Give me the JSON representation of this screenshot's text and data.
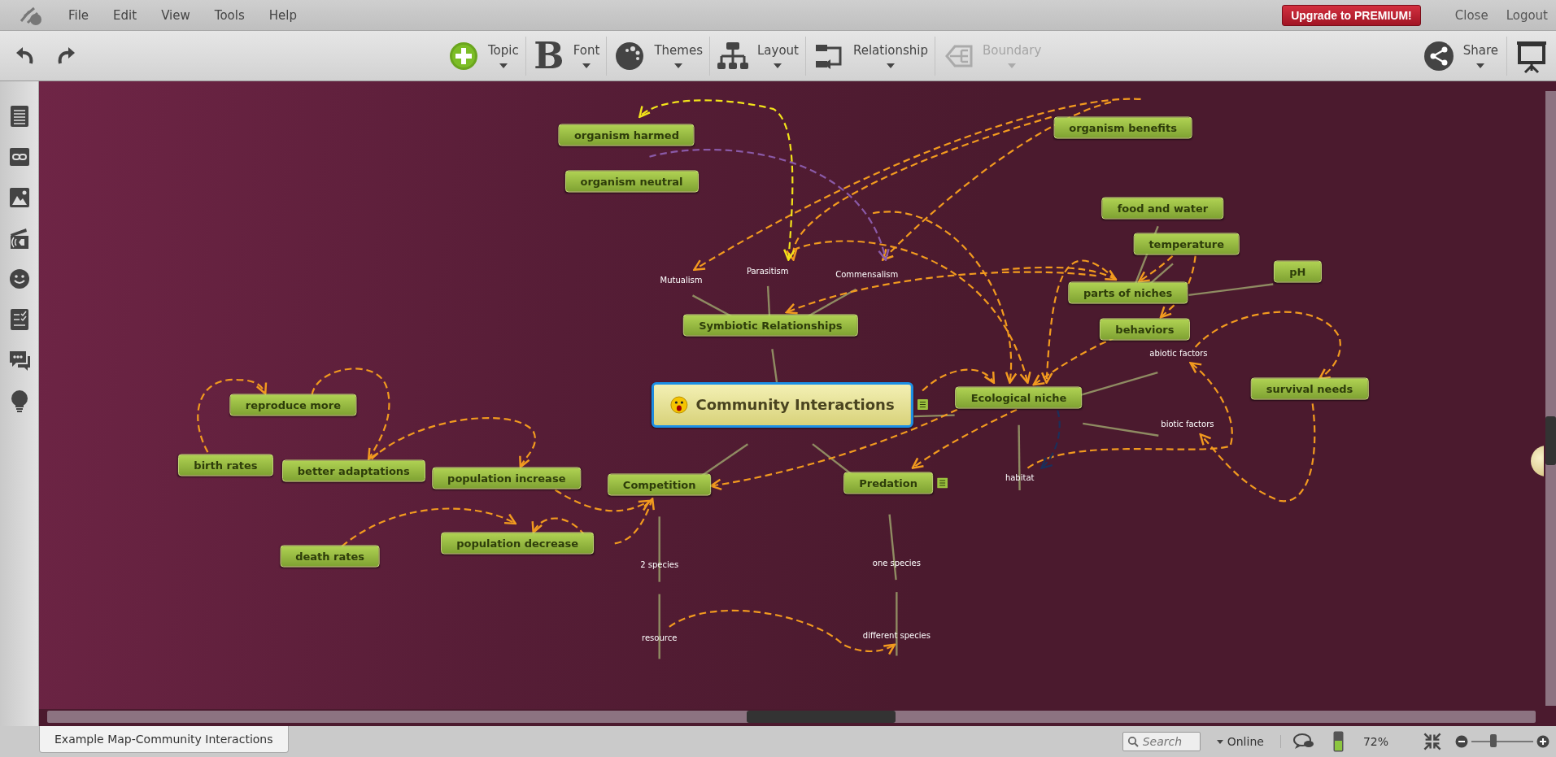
{
  "menu": {
    "items": [
      "File",
      "Edit",
      "View",
      "Tools",
      "Help"
    ],
    "upgrade": "Upgrade to PREMIUM!",
    "links": [
      "Close",
      "Logout"
    ]
  },
  "toolbar": {
    "tools": [
      {
        "label": "Topic",
        "kind": "topic",
        "disabled": false
      },
      {
        "label": "Font",
        "kind": "font",
        "glyph": "B",
        "disabled": false
      },
      {
        "label": "Themes",
        "kind": "themes",
        "disabled": false
      },
      {
        "label": "Layout",
        "kind": "layout",
        "disabled": false
      },
      {
        "label": "Relationship",
        "kind": "relationship",
        "disabled": false
      },
      {
        "label": "Boundary",
        "kind": "boundary",
        "disabled": true
      }
    ],
    "share": "Share"
  },
  "map": {
    "central": {
      "text": "Community Interactions",
      "kind": "central",
      "selected": true,
      "note": true,
      "children": [
        {
          "text": "Symbiotic Relationships",
          "kind": "topic",
          "selected": false,
          "children": [
            {
              "text": "Mutualism",
              "kind": "label",
              "selected": false
            },
            {
              "text": "Parasitism",
              "kind": "label",
              "selected": false
            },
            {
              "text": "Commensalism",
              "kind": "label",
              "selected": false
            }
          ]
        },
        {
          "text": "Ecological niche",
          "kind": "topic",
          "selected": false,
          "children": [
            {
              "text": "abiotic factors",
              "kind": "label",
              "selected": false
            },
            {
              "text": "biotic factors",
              "kind": "label",
              "selected": false
            },
            {
              "text": "habitat",
              "kind": "label",
              "selected": false
            }
          ]
        },
        {
          "text": "Competition",
          "kind": "topic",
          "selected": false,
          "children": [
            {
              "text": "2 species",
              "kind": "label",
              "selected": false,
              "children": [
                {
                  "text": "resource",
                  "kind": "label",
                  "selected": false
                }
              ]
            }
          ]
        },
        {
          "text": "Predation",
          "kind": "topic",
          "selected": false,
          "note": true,
          "children": [
            {
              "text": "one species",
              "kind": "label",
              "selected": false,
              "children": [
                {
                  "text": "different species",
                  "kind": "label",
                  "selected": false
                }
              ]
            }
          ]
        }
      ]
    },
    "floating": [
      {
        "text": "organism harmed",
        "kind": "topic",
        "selected": false
      },
      {
        "text": "organism neutral",
        "kind": "topic",
        "selected": false
      },
      {
        "text": "organism benefits",
        "kind": "topic",
        "selected": false
      },
      {
        "text": "parts of niches",
        "kind": "topic",
        "selected": false,
        "children": [
          {
            "text": "food and water",
            "kind": "topic",
            "selected": false
          },
          {
            "text": "temperature",
            "kind": "topic",
            "selected": false
          },
          {
            "text": "pH",
            "kind": "topic",
            "selected": false
          }
        ]
      },
      {
        "text": "behaviors",
        "kind": "topic",
        "selected": false
      },
      {
        "text": "survival needs",
        "kind": "topic",
        "selected": false
      },
      {
        "text": "reproduce more",
        "kind": "topic",
        "selected": false
      },
      {
        "text": "birth rates",
        "kind": "topic",
        "selected": false
      },
      {
        "text": "better adaptations",
        "kind": "topic",
        "selected": false
      },
      {
        "text": "population increase",
        "kind": "topic",
        "selected": false
      },
      {
        "text": "death rates",
        "kind": "topic",
        "selected": false
      },
      {
        "text": "population decrease",
        "kind": "topic",
        "selected": false
      }
    ]
  },
  "document_tab": "Example Map-Community Interactions",
  "status_bar": {
    "search": {
      "placeholder": "Search"
    },
    "status": "Online",
    "zoom": "72%",
    "zoom_slider": {
      "level": 0.35
    }
  }
}
